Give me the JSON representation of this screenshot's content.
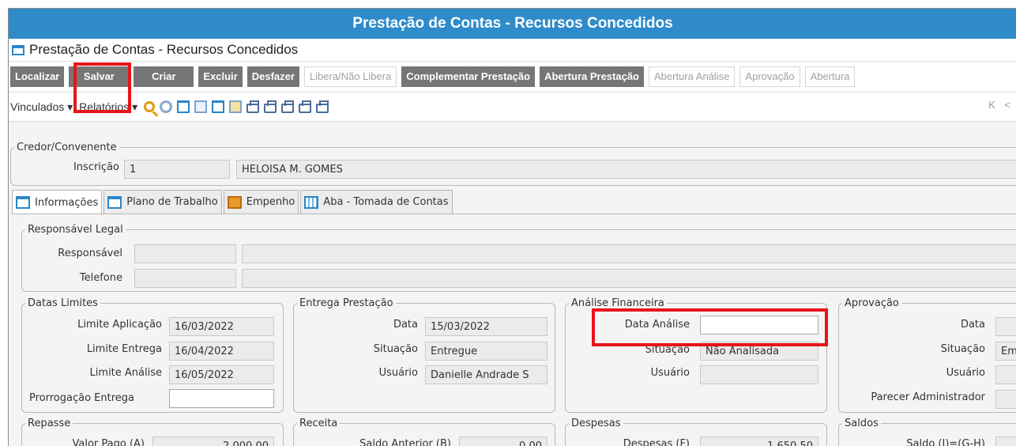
{
  "window": {
    "title": "Prestação de Contas - Recursos Concedidos"
  },
  "form": {
    "title": "Prestação de Contas - Recursos Concedidos"
  },
  "toolbar": {
    "buttons": [
      "Localizar",
      "Salvar",
      "Criar",
      "Excluir",
      "Desfazer",
      "Libera/Não Libera",
      "Complementar Prestação",
      "Abertura Prestação",
      "Abertura Análise",
      "Aprovação",
      "Abertura"
    ],
    "menus": [
      "Vinculados",
      "Relatórios"
    ],
    "nav": "K <"
  },
  "credor": {
    "legend": "Credor/Convenente",
    "inscricao_label": "Inscrição",
    "inscricao_value": "1",
    "nome_value": "HELOISA M. GOMES"
  },
  "tabs": [
    "Informações",
    "Plano de Trabalho",
    "Empenho",
    "Aba - Tomada de Contas"
  ],
  "responsavel": {
    "legend": "Responsável Legal",
    "responsavel_label": "Responsável",
    "telefone_label": "Telefone"
  },
  "datas": {
    "legend": "Datas Limites",
    "aplicacao_label": "Limite Aplicação",
    "aplicacao_value": "16/03/2022",
    "entrega_label": "Limite Entrega",
    "entrega_value": "16/04/2022",
    "analise_label": "Limite Análise",
    "analise_value": "16/05/2022",
    "prorrogacao_label": "Prorrogação Entrega",
    "prorrogacao_value": ""
  },
  "entrega": {
    "legend": "Entrega Prestação",
    "data_label": "Data",
    "data_value": "15/03/2022",
    "situacao_label": "Situação",
    "situacao_value": "Entregue",
    "usuario_label": "Usuário",
    "usuario_value": "Danielle Andrade S"
  },
  "analise": {
    "legend": "Análise Financeira",
    "data_label": "Data Análise",
    "data_value": "",
    "situacao_label": "Situação",
    "situacao_value": "Não Analisada",
    "usuario_label": "Usuário",
    "usuario_value": ""
  },
  "aprovacao": {
    "legend": "Aprovação",
    "data_label": "Data",
    "situacao_label": "Situação",
    "situacao_value": "Em",
    "usuario_label": "Usuário",
    "parecer_label": "Parecer Administrador"
  },
  "repasse": {
    "legend": "Repasse",
    "valor_pago_label": "Valor Pago (A)",
    "valor_pago_value": "2.000,00"
  },
  "receita": {
    "legend": "Receita",
    "saldo_anterior_label": "Saldo Anterior (B)",
    "saldo_anterior_value": "0,00"
  },
  "despesas": {
    "legend": "Despesas",
    "despesas_label": "Despesas (F)",
    "despesas_value": "1.650,50"
  },
  "saldos": {
    "legend": "Saldos",
    "saldo_label": "Saldo (I)=(G-H)"
  },
  "colors": {
    "titlebar": "#2f8bc9",
    "button": "#767676",
    "highlight": "#e8141b"
  }
}
